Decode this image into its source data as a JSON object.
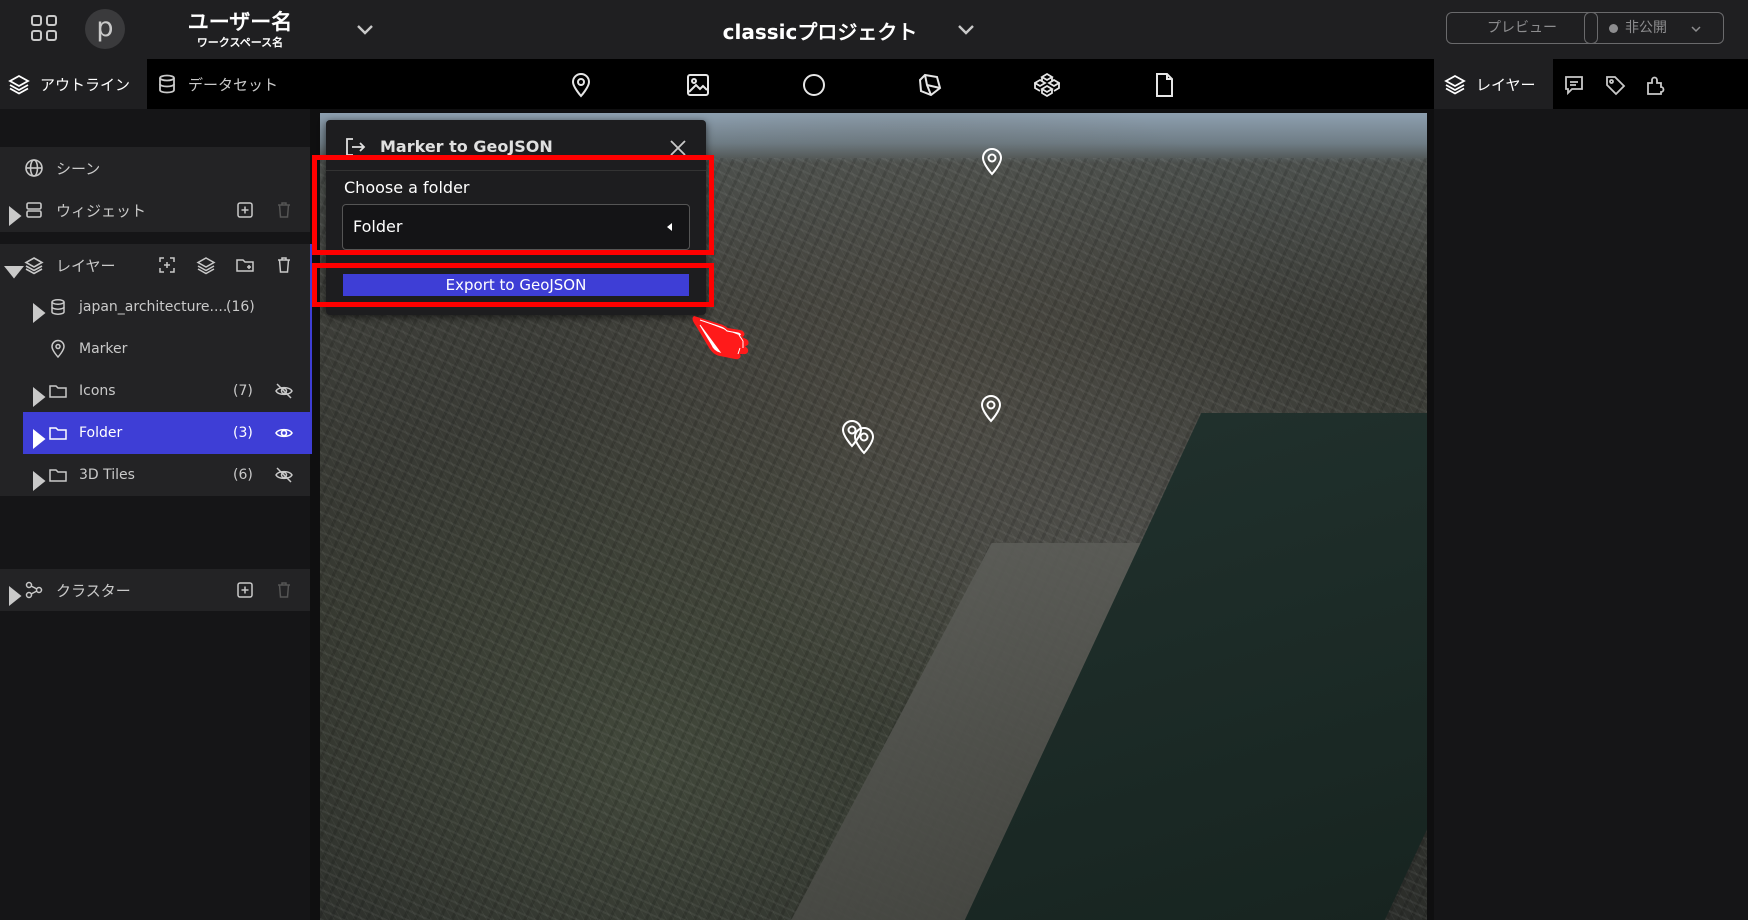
{
  "header": {
    "user_name": "ユーザー名",
    "workspace_name": "ワークスペース名",
    "avatar_letter": "p",
    "project_name": "classicプロジェクト",
    "preview_label": "プレビュー",
    "publish_status": "非公開"
  },
  "tabs": {
    "outline": "アウトライン",
    "dataset": "データセット",
    "layer_right": "レイヤー"
  },
  "left_panel": {
    "scene": "シーン",
    "widget": "ウィジェット",
    "layers_header": "レイヤー",
    "layers": [
      {
        "label": "japan_architecture....",
        "count": "(16)"
      },
      {
        "label": "Marker",
        "count": ""
      },
      {
        "label": "Icons",
        "count": "(7)"
      },
      {
        "label": "Folder",
        "count": "(3)"
      },
      {
        "label": "3D Tiles",
        "count": "(6)"
      }
    ],
    "cluster": "クラスター"
  },
  "popup": {
    "title": "Marker to GeoJSON",
    "choose_label": "Choose a folder",
    "select_value": "Folder",
    "export_button": "Export to GeoJSON"
  },
  "colors": {
    "accent": "#3e3ed6",
    "highlight": "#ff0000",
    "panel": "#151517",
    "header": "#1f1f21"
  }
}
